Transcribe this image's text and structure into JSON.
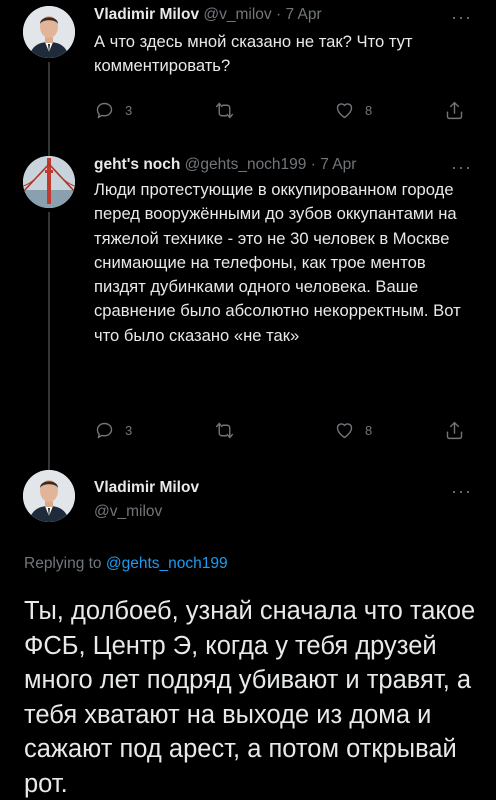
{
  "tweets": [
    {
      "name": "Vladimir Milov",
      "handle": "@v_milov",
      "time": "7 Apr",
      "text": "А что здесь мной сказано не так? Что тут комментировать?",
      "replies": "3",
      "likes": "8"
    },
    {
      "name": "geht's noch",
      "handle": "@gehts_noch199",
      "time": "7 Apr",
      "text": "Люди протестующие в оккупированном городе перед вооружёнными до зубов оккупантами на тяжелой технике - это не 30 человек в Москве снимающие на телефоны, как трое ментов пиздят дубинками одного человека. Ваше сравнение было абсолютно некорректным. Вот что было сказано «не так»",
      "replies": "3",
      "likes": "8"
    }
  ],
  "main_tweet": {
    "name": "Vladimir Milov",
    "handle": "@v_milov",
    "replying_prefix": "Replying to",
    "replying_handle": "@gehts_noch199",
    "text": "Ты, долбоеб, узнай сначала что такое ФСБ, Центр Э, когда у тебя друзей много лет подряд убивают и травят, а тебя хватают на выходе из дома и сажают под арест, а потом открывай рот."
  },
  "more_label": "···",
  "separator": "·",
  "icons": [
    "reply-icon",
    "retweet-icon",
    "like-icon",
    "share-icon",
    "more-icon"
  ],
  "colors": {
    "background": "#000000",
    "text": "#e7e9ea",
    "muted": "#71767b",
    "link": "#1d9bf0"
  }
}
